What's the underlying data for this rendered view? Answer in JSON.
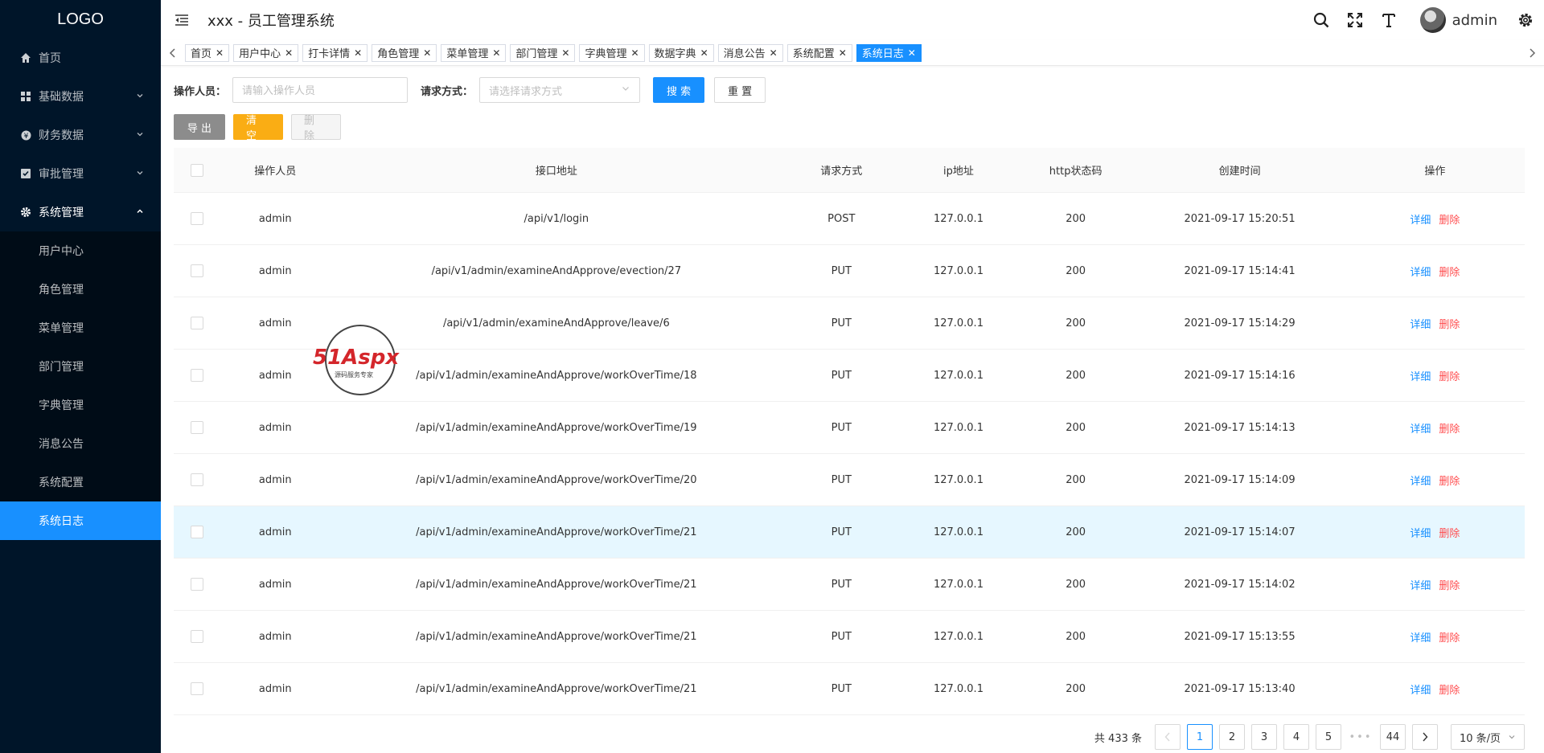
{
  "sidebar": {
    "logo": "LOGO",
    "menu": [
      {
        "label": "首页",
        "icon": "home-icon"
      },
      {
        "label": "基础数据",
        "icon": "grid-icon"
      },
      {
        "label": "财务数据",
        "icon": "money-icon"
      },
      {
        "label": "审批管理",
        "icon": "checkbox-icon"
      },
      {
        "label": "系统管理",
        "icon": "gear-icon"
      }
    ],
    "submenu": [
      "用户中心",
      "角色管理",
      "菜单管理",
      "部门管理",
      "字典管理",
      "消息公告",
      "系统配置",
      "系统日志"
    ],
    "active_submenu": "系统日志"
  },
  "header": {
    "title": "xxx - 员工管理系统",
    "username": "admin"
  },
  "tabs": [
    "首页",
    "用户中心",
    "打卡详情",
    "角色管理",
    "菜单管理",
    "部门管理",
    "字典管理",
    "数据字典",
    "消息公告",
    "系统配置",
    "系统日志"
  ],
  "active_tab": "系统日志",
  "search": {
    "operator_label": "操作人员：",
    "operator_placeholder": "请输入操作人员",
    "method_label": "请求方式：",
    "method_placeholder": "请选择请求方式",
    "search_button": "搜 索",
    "reset_button": "重 置"
  },
  "actions": {
    "export": "导 出",
    "clear": "清 空",
    "delete": "删 除"
  },
  "table": {
    "columns": [
      "操作人员",
      "接口地址",
      "请求方式",
      "ip地址",
      "http状态码",
      "创建时间",
      "操作"
    ],
    "detail_label": "详细",
    "delete_label": "删除",
    "rows": [
      {
        "user": "admin",
        "url": "/api/v1/login",
        "method": "POST",
        "ip": "127.0.0.1",
        "code": "200",
        "time": "2021-09-17 15:20:51"
      },
      {
        "user": "admin",
        "url": "/api/v1/admin/examineAndApprove/evection/27",
        "method": "PUT",
        "ip": "127.0.0.1",
        "code": "200",
        "time": "2021-09-17 15:14:41"
      },
      {
        "user": "admin",
        "url": "/api/v1/admin/examineAndApprove/leave/6",
        "method": "PUT",
        "ip": "127.0.0.1",
        "code": "200",
        "time": "2021-09-17 15:14:29"
      },
      {
        "user": "admin",
        "url": "/api/v1/admin/examineAndApprove/workOverTime/18",
        "method": "PUT",
        "ip": "127.0.0.1",
        "code": "200",
        "time": "2021-09-17 15:14:16"
      },
      {
        "user": "admin",
        "url": "/api/v1/admin/examineAndApprove/workOverTime/19",
        "method": "PUT",
        "ip": "127.0.0.1",
        "code": "200",
        "time": "2021-09-17 15:14:13"
      },
      {
        "user": "admin",
        "url": "/api/v1/admin/examineAndApprove/workOverTime/20",
        "method": "PUT",
        "ip": "127.0.0.1",
        "code": "200",
        "time": "2021-09-17 15:14:09"
      },
      {
        "user": "admin",
        "url": "/api/v1/admin/examineAndApprove/workOverTime/21",
        "method": "PUT",
        "ip": "127.0.0.1",
        "code": "200",
        "time": "2021-09-17 15:14:07"
      },
      {
        "user": "admin",
        "url": "/api/v1/admin/examineAndApprove/workOverTime/21",
        "method": "PUT",
        "ip": "127.0.0.1",
        "code": "200",
        "time": "2021-09-17 15:14:02"
      },
      {
        "user": "admin",
        "url": "/api/v1/admin/examineAndApprove/workOverTime/21",
        "method": "PUT",
        "ip": "127.0.0.1",
        "code": "200",
        "time": "2021-09-17 15:13:55"
      },
      {
        "user": "admin",
        "url": "/api/v1/admin/examineAndApprove/workOverTime/21",
        "method": "PUT",
        "ip": "127.0.0.1",
        "code": "200",
        "time": "2021-09-17 15:13:40"
      }
    ],
    "highlighted_row": 6
  },
  "pagination": {
    "total": "共 433 条",
    "pages": [
      "1",
      "2",
      "3",
      "4",
      "5"
    ],
    "ellipsis": "•••",
    "last_page": "44",
    "current": "1",
    "page_size": "10 条/页"
  },
  "watermark": {
    "brand": "51Aspx",
    "tagline": "源码服务专家"
  },
  "colors": {
    "sidebar_bg": "#001529",
    "submenu_bg": "#000c17",
    "primary": "#1890ff",
    "danger": "#ff4d4f",
    "warning": "#faad14",
    "export_gray": "#8c8c8c"
  }
}
